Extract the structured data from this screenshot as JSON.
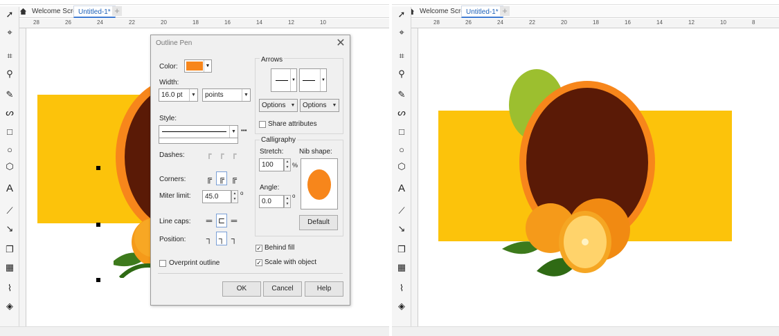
{
  "tabs": {
    "welcome": "Welcome Screen",
    "document": "Untitled-1*"
  },
  "ruler": {
    "left_labels": [
      "28",
      "26",
      "24",
      "22",
      "20",
      "18",
      "16",
      "14",
      "12",
      "10"
    ],
    "right_labels": [
      "28",
      "26",
      "24",
      "22",
      "20",
      "18",
      "16",
      "14",
      "12",
      "10",
      "8"
    ]
  },
  "dialog": {
    "title": "Outline Pen",
    "color_label": "Color:",
    "color_value": "#f7861b",
    "width_label": "Width:",
    "width_value": "16.0 pt",
    "width_units": "points",
    "style_label": "Style:",
    "dashes_label": "Dashes:",
    "corners_label": "Corners:",
    "miter_label": "Miter limit:",
    "miter_value": "45.0",
    "miter_unit": "o",
    "linecaps_label": "Line caps:",
    "position_label": "Position:",
    "overprint_label": "Overprint outline",
    "arrows_label": "Arrows",
    "options_label_1": "Options",
    "options_label_2": "Options",
    "share_label": "Share attributes",
    "calligraphy_label": "Calligraphy",
    "stretch_label": "Stretch:",
    "stretch_value": "100",
    "stretch_unit": "%",
    "nib_label": "Nib shape:",
    "angle_label": "Angle:",
    "angle_value": "0.0",
    "angle_unit": "o",
    "default_label": "Default",
    "behind_fill_label": "Behind fill",
    "scale_label": "Scale with object",
    "ok_label": "OK",
    "cancel_label": "Cancel",
    "help_label": "Help",
    "more_label": "▪▪▪"
  },
  "colors": {
    "yellow": "#fcc30b",
    "orange_ring": "#f7861b",
    "dark_brown": "#5a1a06",
    "green_circle": "#9cbf2f",
    "accent": "#3f7ad1"
  },
  "icons": {
    "pick_tool": "arrow-pointer",
    "freehand": "freehand-pick",
    "crop": "crop",
    "zoom": "magnifier",
    "freehand_draw": "curve",
    "artistic": "spiral",
    "rectangle": "rectangle",
    "ellipse": "ellipse",
    "polygon": "polygon",
    "text": "text-A",
    "line": "parallel-dimension",
    "connector": "connector",
    "drop_shadow": "drop-shadow",
    "transparency": "checkerboard",
    "eyedropper": "eyedropper",
    "fill": "interactive-fill"
  }
}
